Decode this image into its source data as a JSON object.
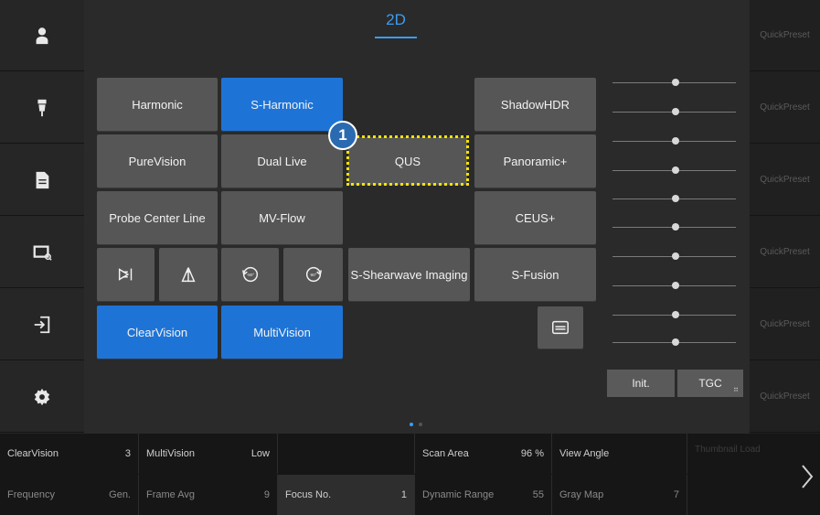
{
  "main": {
    "tab": "2D",
    "callout_number": "1"
  },
  "buttons": {
    "harmonic": "Harmonic",
    "s_harmonic": "S-Harmonic",
    "shadowhdr": "ShadowHDR",
    "purevision": "PureVision",
    "dual_live": "Dual Live",
    "qus": "QUS",
    "panoramic": "Panoramic+",
    "probe_center_line": "Probe Center Line",
    "mv_flow": "MV-Flow",
    "ceus": "CEUS+",
    "s_shearwave": "S-Shearwave Imaging",
    "s_fusion": "S-Fusion",
    "clearvision": "ClearVision",
    "multivision": "MultiVision",
    "rotate_minus": "-90°",
    "rotate_plus": "90°"
  },
  "tgc": {
    "init_label": "Init.",
    "tgc_label": "TGC",
    "tgc_dots": "⠶"
  },
  "quick_presets": [
    "QuickPreset",
    "QuickPreset",
    "QuickPreset",
    "QuickPreset",
    "QuickPreset",
    "QuickPreset"
  ],
  "bottom_bar": {
    "row1": [
      {
        "label": "ClearVision",
        "value": "3"
      },
      {
        "label": "MultiVision",
        "value": "Low"
      },
      {
        "label": "",
        "value": ""
      },
      {
        "label": "Scan Area",
        "value": "96 %"
      },
      {
        "label": "View Angle",
        "value": ""
      }
    ],
    "row2": [
      {
        "label": "Frequency",
        "value": "Gen."
      },
      {
        "label": "Frame Avg",
        "value": "9"
      },
      {
        "label": "Focus No.",
        "value": "1"
      },
      {
        "label": "Dynamic Range",
        "value": "55"
      },
      {
        "label": "Gray Map",
        "value": "7"
      }
    ],
    "thumbnail_label": "Thumbnail Load"
  },
  "icons": {
    "sidebar": [
      "user-icon",
      "probe-icon",
      "report-icon",
      "review-icon",
      "exit-icon",
      "settings-icon"
    ]
  },
  "colors": {
    "accent": "#1e74d6",
    "tab_active": "#3d9cf0",
    "highlight": "#f5e400"
  }
}
